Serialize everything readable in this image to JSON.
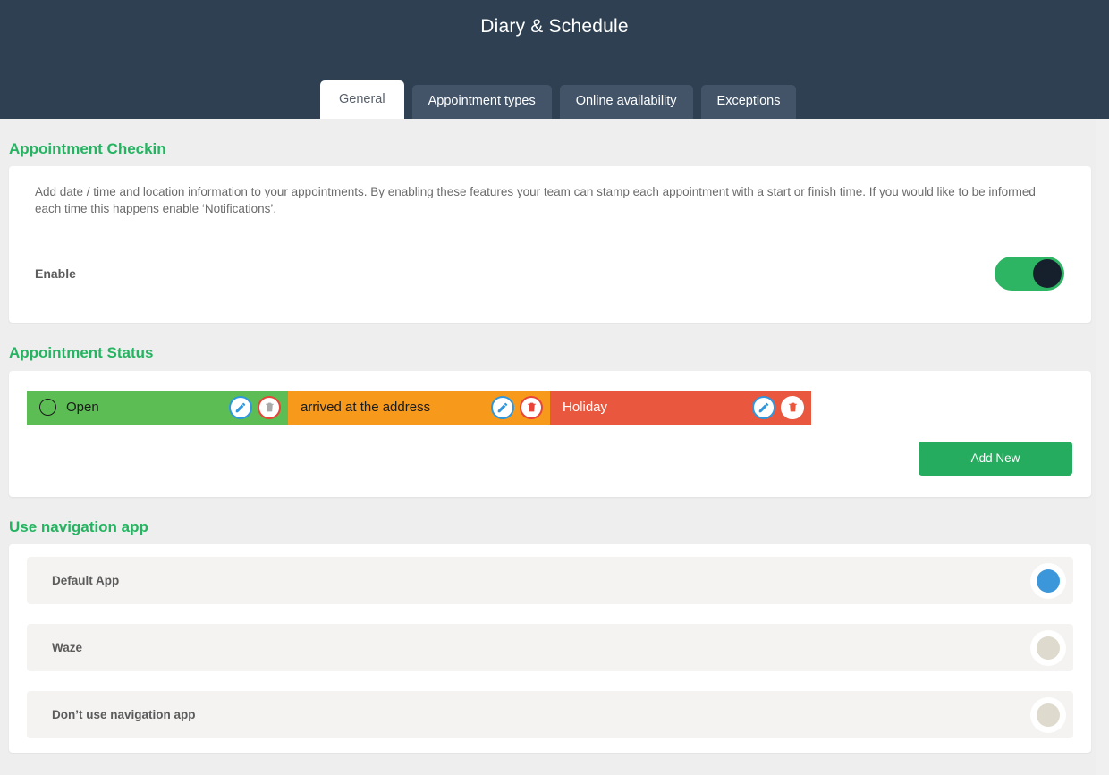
{
  "header": {
    "title": "Diary & Schedule",
    "tabs": [
      {
        "label": "General",
        "active": true
      },
      {
        "label": "Appointment types",
        "active": false
      },
      {
        "label": "Online availability",
        "active": false
      },
      {
        "label": "Exceptions",
        "active": false
      }
    ]
  },
  "sections": {
    "checkin": {
      "title": "Appointment Checkin",
      "description": "Add date / time and location information to your appointments. By enabling these features your team can stamp each appointment with a start or finish time. If you would like to be informed each time this happens enable ‘Notifications’.",
      "enable_label": "Enable",
      "enable_state": "on"
    },
    "status": {
      "title": "Appointment Status",
      "chips": [
        {
          "label": "Open",
          "color": "#5cbd54",
          "text_color": "#1b1b1b",
          "has_radio": true,
          "edit_icon": "pencil-icon",
          "delete_icon": "trash-icon",
          "delete_state": "disabled"
        },
        {
          "label": "arrived at the address",
          "color": "#f79a1c",
          "text_color": "#1b1b1b",
          "has_radio": false,
          "edit_icon": "pencil-icon",
          "delete_icon": "trash-icon",
          "delete_state": "enabled"
        },
        {
          "label": "Holiday",
          "color": "#e9573f",
          "text_color": "#ffffff",
          "has_radio": false,
          "edit_icon": "pencil-icon",
          "delete_icon": "trash-icon",
          "delete_state": "enabled"
        }
      ],
      "add_new_label": "Add New"
    },
    "navigation": {
      "title": "Use navigation app",
      "options": [
        {
          "label": "Default App",
          "selected": true
        },
        {
          "label": "Waze",
          "selected": false
        },
        {
          "label": "Don’t use navigation app",
          "selected": false
        }
      ]
    }
  },
  "colors": {
    "header_bg": "#2e4052",
    "tab_bg": "#435468",
    "accent_green": "#24b461",
    "toggle_on": "#2db563",
    "add_button": "#25ac5f",
    "radio_selected": "#3b97d9",
    "radio_unselected": "#dedacd",
    "page_bg": "#eeeeee"
  }
}
